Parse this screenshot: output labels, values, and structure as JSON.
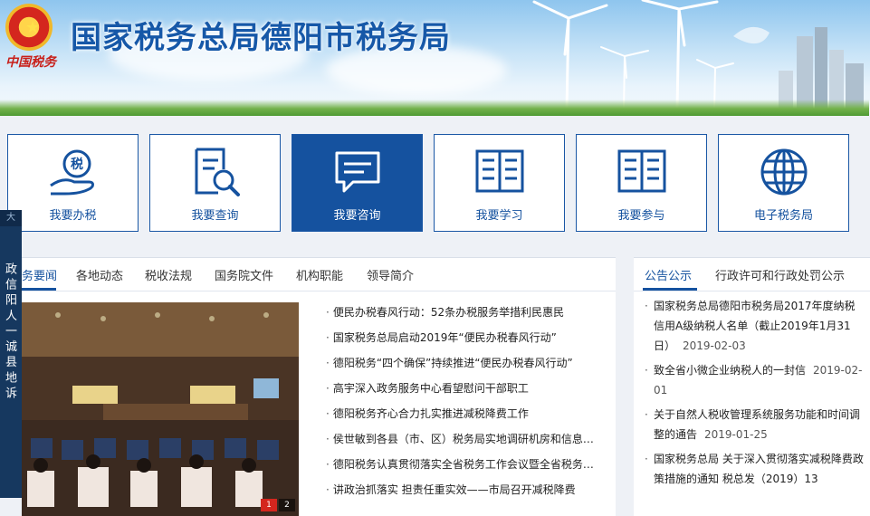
{
  "site": {
    "title": "国家税务总局德阳市税务局",
    "logo_text": "中国税务"
  },
  "services": [
    {
      "label": "我要办税",
      "icon": "tax-hand-icon"
    },
    {
      "label": "我要查询",
      "icon": "document-search-icon"
    },
    {
      "label": "我要咨询",
      "icon": "chat-bubble-icon"
    },
    {
      "label": "我要学习",
      "icon": "open-book-icon"
    },
    {
      "label": "我要参与",
      "icon": "open-book-icon"
    },
    {
      "label": "电子税务局",
      "icon": "globe-icon"
    }
  ],
  "side_strip": {
    "tab": "大",
    "text": "政 信 阳 人 一 诚 县 地 诉"
  },
  "news": {
    "tabs": [
      "务要闻",
      "各地动态",
      "税收法规",
      "国务院文件",
      "机构职能",
      "领导简介"
    ],
    "pager": [
      "1",
      "2"
    ],
    "items": [
      "便民办税春风行动：52条办税服务举措利民惠民",
      "国家税务总局启动2019年“便民办税春风行动”",
      "德阳税务“四个确保”持续推进“便民办税春风行动”",
      "高宇深入政务服务中心看望慰问干部职工",
      "德阳税务齐心合力扎实推进减税降费工作",
      "侯世敏到各县（市、区）税务局实地调研机房和信息…",
      "德阳税务认真贯彻落实全省税务工作会议暨全省税务…",
      "讲政治抓落实 担责任重实效——市局召开减税降费"
    ]
  },
  "notices": {
    "tabs": [
      "公告公示",
      "行政许可和行政处罚公示"
    ],
    "items": [
      {
        "text": "国家税务总局德阳市税务局2017年度纳税信用A级纳税人名单（截止2019年1月31日）",
        "date": "2019-02-03"
      },
      {
        "text": "致全省小微企业纳税人的一封信",
        "date": "2019-02-01"
      },
      {
        "text": "关于自然人税收管理系统服务功能和时间调整的通告",
        "date": "2019-01-25"
      },
      {
        "text": "国家税务总局 关于深入贯彻落实减税降费政策措施的通知 税总发（2019）13",
        "date": ""
      }
    ]
  },
  "colors": {
    "brand_blue": "#15529f",
    "emblem_red": "#d4261e",
    "side_strip": "#16385f"
  }
}
